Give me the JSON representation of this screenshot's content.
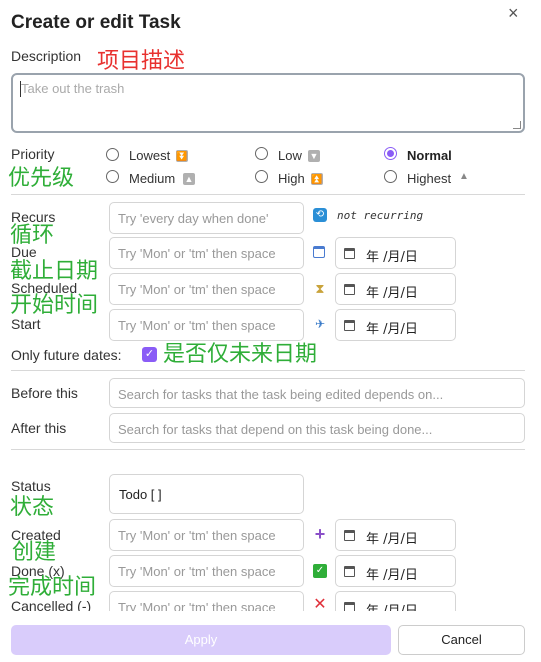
{
  "dialog": {
    "title": "Create or edit Task",
    "close_glyph": "×"
  },
  "annotations": {
    "description": "项目描述",
    "priority": "优先级",
    "recurs": "循环",
    "due": "截止日期",
    "scheduled": "开始时间",
    "future": "是否仅未来日期",
    "status": "状态",
    "created": "创建",
    "done": "完成时间"
  },
  "description": {
    "label": "Description",
    "placeholder": "Take out the trash"
  },
  "priority": {
    "label": "Priority",
    "options": [
      {
        "label": "Lowest",
        "icon": "double-chevron-down-icon",
        "checked": false
      },
      {
        "label": "Low",
        "icon": "chevron-down-icon",
        "checked": false
      },
      {
        "label": "Normal",
        "icon": "",
        "checked": true
      },
      {
        "label": "Medium",
        "icon": "chevron-up-icon",
        "checked": false
      },
      {
        "label": "High",
        "icon": "double-chevron-up-icon",
        "checked": false
      },
      {
        "label": "Highest",
        "icon": "triangle-up-icon",
        "checked": false
      }
    ]
  },
  "recurs": {
    "label": "Recurs",
    "placeholder": "Try 'every day when done'",
    "icon": "repeat-icon",
    "status": "not recurring"
  },
  "due": {
    "label": "Due",
    "placeholder": "Try 'Mon' or 'tm' then space",
    "icon": "calendar-icon",
    "date": "年 /月/日"
  },
  "scheduled": {
    "label": "Scheduled",
    "placeholder": "Try 'Mon' or 'tm' then space",
    "icon": "hourglass-icon",
    "date": "年 /月/日"
  },
  "start": {
    "label": "Start",
    "placeholder": "Try 'Mon' or 'tm' then space",
    "icon": "plane-departure-icon",
    "date": "年 /月/日"
  },
  "future": {
    "label": "Only future dates:",
    "checked": true
  },
  "before": {
    "label": "Before this",
    "placeholder": "Search for tasks that the task being edited depends on..."
  },
  "after": {
    "label": "After this",
    "placeholder": "Search for tasks that depend on this task being done..."
  },
  "status": {
    "label": "Status",
    "value": "Todo [ ]"
  },
  "created": {
    "label": "Created",
    "placeholder": "Try 'Mon' or 'tm' then space",
    "icon": "plus-icon",
    "date": "年 /月/日"
  },
  "done": {
    "label": "Done (x)",
    "placeholder": "Try 'Mon' or 'tm' then space",
    "icon": "check-box-icon",
    "date": "年 /月/日"
  },
  "cancelled": {
    "label": "Cancelled (-)",
    "placeholder": "Try 'Mon' or 'tm' then space",
    "icon": "x-icon",
    "date": "年 /月/日"
  },
  "buttons": {
    "apply": "Apply",
    "cancel": "Cancel"
  },
  "colors": {
    "accent": "#8a5cf6",
    "annotation_red": "#e8312f",
    "annotation_green": "#2fae38",
    "apply_disabled": "#d9ccfb"
  }
}
